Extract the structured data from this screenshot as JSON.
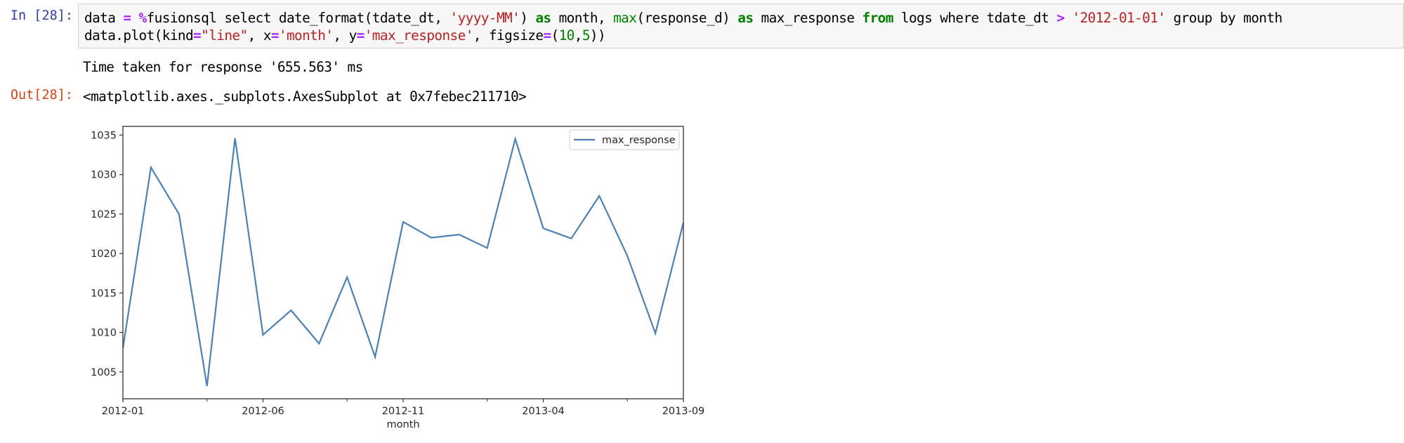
{
  "cell": {
    "in_prompt": "In [28]:",
    "out_prompt": "Out[28]:",
    "code_line1": [
      {
        "t": "data ",
        "c": ""
      },
      {
        "t": "=",
        "c": "op"
      },
      {
        "t": " ",
        "c": ""
      },
      {
        "t": "%",
        "c": "op"
      },
      {
        "t": "fusionsql select date_format(tdate_dt, ",
        "c": ""
      },
      {
        "t": "'yyyy-MM'",
        "c": "str"
      },
      {
        "t": ") ",
        "c": ""
      },
      {
        "t": "as",
        "c": "kw"
      },
      {
        "t": " month, ",
        "c": ""
      },
      {
        "t": "max",
        "c": "bi"
      },
      {
        "t": "(response_d) ",
        "c": ""
      },
      {
        "t": "as",
        "c": "kw"
      },
      {
        "t": " max_response ",
        "c": ""
      },
      {
        "t": "from",
        "c": "kw"
      },
      {
        "t": " logs where tdate_dt ",
        "c": ""
      },
      {
        "t": ">",
        "c": "op"
      },
      {
        "t": " ",
        "c": ""
      },
      {
        "t": "'2012-01-01'",
        "c": "str"
      },
      {
        "t": " group by month",
        "c": ""
      }
    ],
    "code_line2": [
      {
        "t": "data.plot(kind",
        "c": ""
      },
      {
        "t": "=",
        "c": "op"
      },
      {
        "t": "\"line\"",
        "c": "str"
      },
      {
        "t": ", x",
        "c": ""
      },
      {
        "t": "=",
        "c": "op"
      },
      {
        "t": "'month'",
        "c": "str"
      },
      {
        "t": ", y",
        "c": ""
      },
      {
        "t": "=",
        "c": "op"
      },
      {
        "t": "'max_response'",
        "c": "str"
      },
      {
        "t": ", figsize",
        "c": ""
      },
      {
        "t": "=",
        "c": "op"
      },
      {
        "t": "(",
        "c": ""
      },
      {
        "t": "10",
        "c": "num"
      },
      {
        "t": ",",
        "c": ""
      },
      {
        "t": "5",
        "c": "num"
      },
      {
        "t": "))",
        "c": ""
      }
    ],
    "stdout": "Time taken for response '655.563' ms",
    "output_repr": "<matplotlib.axes._subplots.AxesSubplot at 0x7febec211710>"
  },
  "chart_data": {
    "type": "line",
    "title": "",
    "xlabel": "month",
    "ylabel": "",
    "x": [
      "2012-01",
      "2012-02",
      "2012-03",
      "2012-04",
      "2012-05",
      "2012-06",
      "2012-07",
      "2012-08",
      "2012-09",
      "2012-10",
      "2012-11",
      "2012-12",
      "2013-01",
      "2013-02",
      "2013-03",
      "2013-04",
      "2013-05",
      "2013-06",
      "2013-07",
      "2013-08",
      "2013-09"
    ],
    "series": [
      {
        "name": "max_response",
        "color": "#4c80b6",
        "values": [
          1008.0,
          1030.9,
          1025.0,
          1003.2,
          1034.6,
          1009.7,
          1012.8,
          1008.6,
          1017.0,
          1006.9,
          1024.0,
          1022.0,
          1022.4,
          1020.7,
          1034.5,
          1023.2,
          1021.9,
          1027.3,
          1019.7,
          1009.9,
          1023.9
        ]
      }
    ],
    "ylim": [
      1001.6,
      1036.1
    ],
    "yticks": [
      1005,
      1010,
      1015,
      1020,
      1025,
      1030,
      1035
    ],
    "xtick_labels": [
      "2012-01",
      "2012-06",
      "2012-11",
      "2013-04",
      "2013-09"
    ],
    "xtick_major_index": [
      0,
      5,
      10,
      15,
      20
    ],
    "xtick_minor_index": [
      3,
      8,
      13,
      18
    ],
    "legend": {
      "entries": [
        "max_response"
      ],
      "placement": "top-right"
    },
    "grid": false
  }
}
